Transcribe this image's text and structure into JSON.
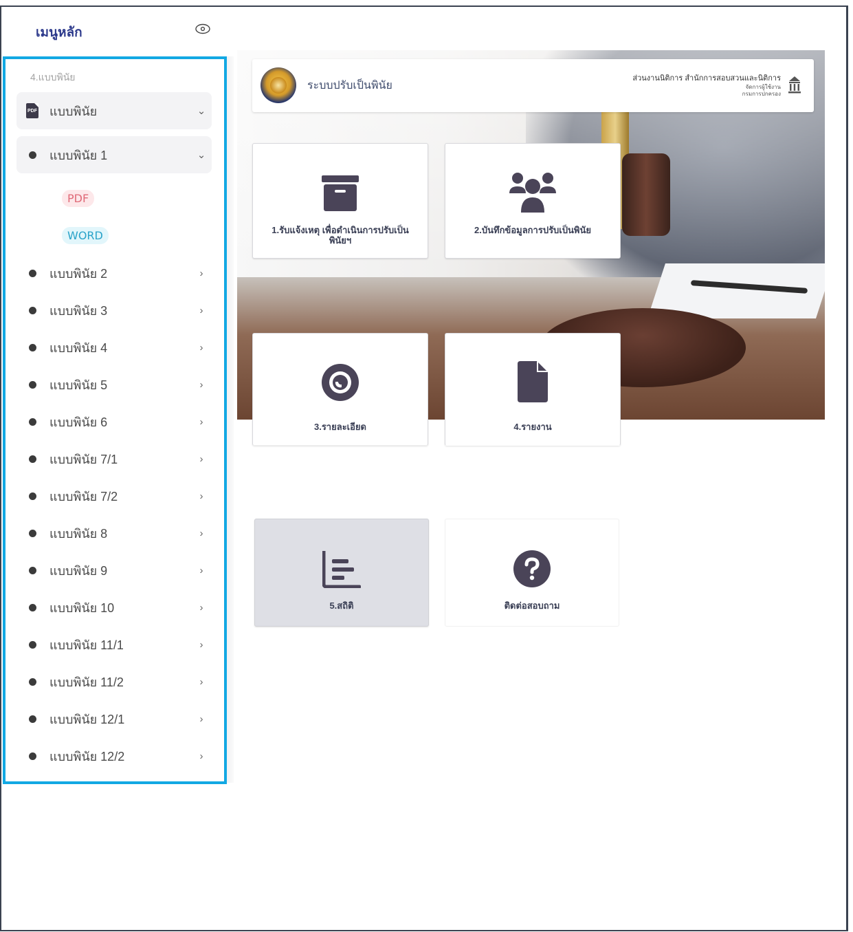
{
  "sidebar": {
    "title": "เมนูหลัก",
    "section_label": "4.แบบพินัย",
    "group": {
      "label": "แบบพินัย"
    },
    "items": [
      {
        "label": "แบบพินัย 1",
        "expanded": true
      },
      {
        "label": "แบบพินัย 2"
      },
      {
        "label": "แบบพินัย 3"
      },
      {
        "label": "แบบพินัย 4"
      },
      {
        "label": "แบบพินัย 5"
      },
      {
        "label": "แบบพินัย 6"
      },
      {
        "label": "แบบพินัย 7/1"
      },
      {
        "label": "แบบพินัย 7/2"
      },
      {
        "label": "แบบพินัย 8"
      },
      {
        "label": "แบบพินัย 9"
      },
      {
        "label": "แบบพินัย 10"
      },
      {
        "label": "แบบพินัย 11/1"
      },
      {
        "label": "แบบพินัย 11/2"
      },
      {
        "label": "แบบพินัย 12/1"
      },
      {
        "label": "แบบพินัย 12/2"
      }
    ],
    "sub_badges": {
      "pdf": "PDF",
      "word": "WORD"
    },
    "icons": {
      "collapse": "eye-icon",
      "group": "pdf-file-icon",
      "expanded": "chevron-down-icon",
      "collapsed": "chevron-right-icon"
    }
  },
  "header": {
    "system_name": "ระบบปรับเป็นพินัย",
    "org_name": "ส่วนงานนิติการ สำนักการสอบสวนและนิติการ",
    "org_sub_1": "จัดการผู้ใช้งาน",
    "org_sub_2": "กรมการปกครอง"
  },
  "tiles": [
    {
      "label": "1.รับแจ้งเหตุ เพื่อดำเนินการปรับเป็นพินัยฯ",
      "icon": "archive-icon"
    },
    {
      "label": "2.บันทึกข้อมูลการปรับเป็นพินัย",
      "icon": "users-icon"
    },
    {
      "label": "3.รายละเอียด",
      "icon": "eye-icon"
    },
    {
      "label": "4.รายงาน",
      "icon": "file-icon"
    },
    {
      "label": "5.สถิติ",
      "icon": "chart-icon"
    },
    {
      "label": "ติดต่อสอบถาม",
      "icon": "question-icon"
    }
  ],
  "colors": {
    "sidebar_border": "#12a8e3",
    "menu_title": "#2d3a8c",
    "icon_fill": "#4a4458",
    "pdf_badge": "#e06a78",
    "word_badge": "#2aa3c9"
  }
}
